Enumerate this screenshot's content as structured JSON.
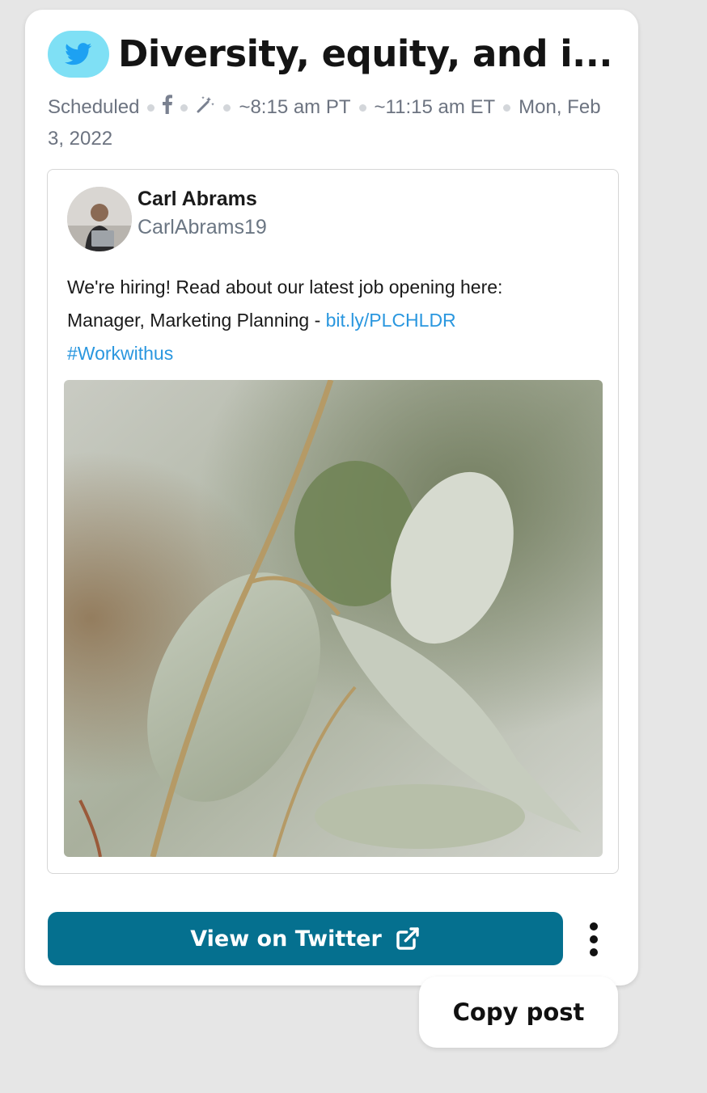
{
  "post": {
    "title": "Diversity, equity, and i...",
    "meta": {
      "status": "Scheduled",
      "time_pt": "~8:15 am PT",
      "time_et": "~11:15 am ET",
      "date": "Mon, Feb 3, 2022"
    },
    "author": {
      "name": "Carl Abrams",
      "handle": "CarlAbrams19"
    },
    "text": {
      "line1": "We're hiring! Read about our latest job opening here:",
      "line2_prefix": "Manager, Marketing Planning - ",
      "link": "bit.ly/PLCHLDR",
      "hashtag": "#Workwithus"
    }
  },
  "actions": {
    "view_label": "View on Twitter",
    "copy_label": "Copy post"
  },
  "icons": {
    "platform": "twitter-bird-icon",
    "facebook": "facebook-icon",
    "magic": "magic-wand-icon",
    "external": "external-link-icon",
    "more": "more-vertical-icon"
  },
  "colors": {
    "twitter_badge": "#7fe0f5",
    "twitter_blue": "#1da1f2",
    "button": "#05708f",
    "link": "#2a97df"
  }
}
